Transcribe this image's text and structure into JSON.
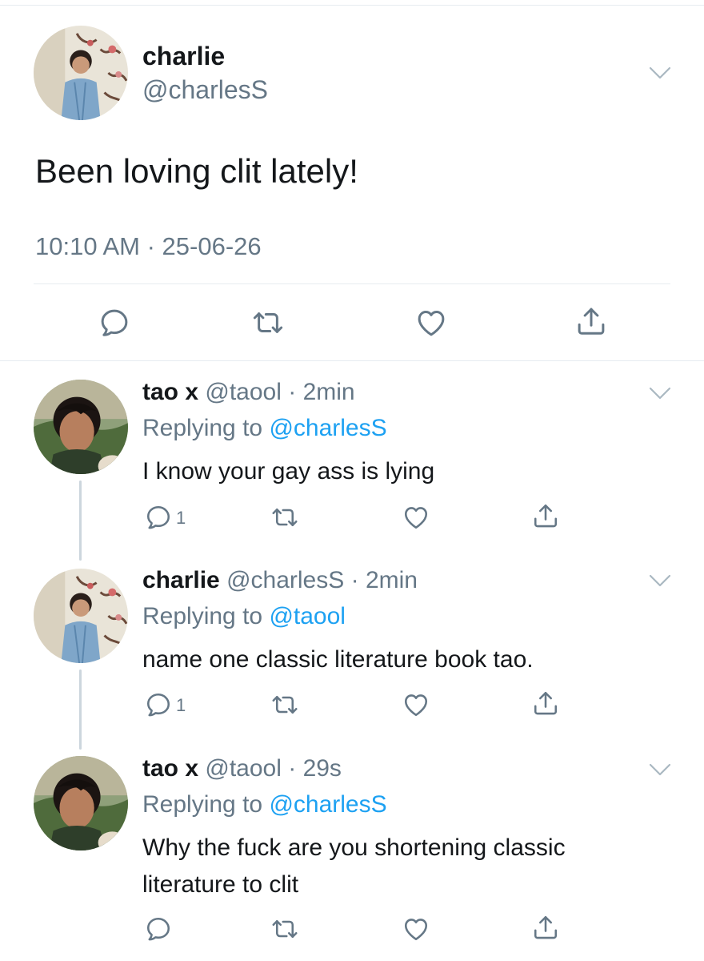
{
  "main_tweet": {
    "name": "charlie",
    "handle": "@charlesS",
    "text": "Been loving clit lately!",
    "timestamp": "10:10 AM · 25-06-26",
    "actions": [
      "reply-icon",
      "retweet-icon",
      "like-icon",
      "share-icon"
    ]
  },
  "replies": [
    {
      "name": "tao x",
      "handle": "@taool",
      "time": "2min",
      "replying_prefix": "Replying to ",
      "replying_to": "@charlesS",
      "text": "I know your gay ass is lying",
      "reply_count": "1"
    },
    {
      "name": "charlie",
      "handle": "@charlesS",
      "time": "2min",
      "replying_prefix": "Replying to ",
      "replying_to": "@taool",
      "text": "name one classic literature book tao.",
      "reply_count": "1"
    },
    {
      "name": "tao x",
      "handle": "@taool",
      "time": "29s",
      "replying_prefix": "Replying to ",
      "replying_to": "@charlesS",
      "text": "Why the fuck are you shortening classic literature to clit",
      "reply_count": ""
    }
  ],
  "separator": " · ",
  "colors": {
    "accent": "#1da1f2",
    "secondary": "#657786",
    "text": "#14171a",
    "divider": "#e6ecf0"
  }
}
